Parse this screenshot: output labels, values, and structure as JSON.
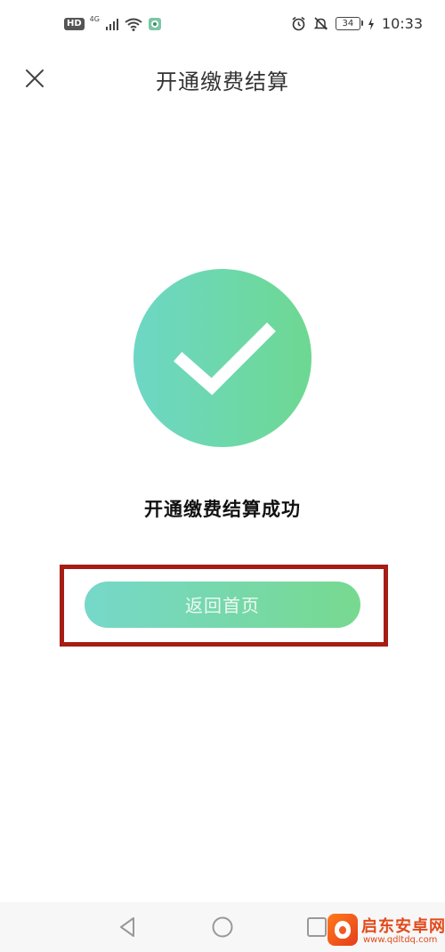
{
  "status_bar": {
    "hd_badge": "HD",
    "network": "4G",
    "battery": "34",
    "time": "10:33"
  },
  "header": {
    "title": "开通缴费结算"
  },
  "main": {
    "success_message": "开通缴费结算成功",
    "home_button_label": "返回首页"
  },
  "watermark": {
    "name": "启东安卓网",
    "url": "www.qdltdq.com"
  },
  "colors": {
    "accent_start": "#6dd7c6",
    "accent_end": "#6dd891",
    "highlight_frame": "#a51d14"
  }
}
